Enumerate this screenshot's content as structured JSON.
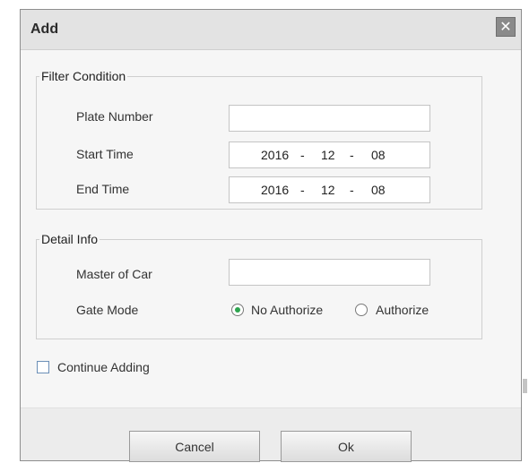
{
  "dialog": {
    "title": "Add",
    "close_glyph": "✕"
  },
  "filter": {
    "legend": "Filter Condition",
    "plate_label": "Plate Number",
    "plate_value": "",
    "start_label": "Start Time",
    "start": {
      "year": "2016",
      "month": "12",
      "day": "08"
    },
    "end_label": "End Time",
    "end": {
      "year": "2016",
      "month": "12",
      "day": "08"
    },
    "date_sep": "-"
  },
  "detail": {
    "legend": "Detail Info",
    "master_label": "Master of Car",
    "master_value": "",
    "gate_label": "Gate Mode",
    "gate_options": [
      {
        "label": "No Authorize",
        "selected": true
      },
      {
        "label": "Authorize",
        "selected": false
      }
    ]
  },
  "continue_adding": {
    "label": "Continue Adding",
    "checked": false
  },
  "buttons": {
    "cancel": "Cancel",
    "ok": "Ok"
  },
  "colors": {
    "radio_selected": "#2ea44f",
    "checkbox_border": "#6b8fb7"
  }
}
